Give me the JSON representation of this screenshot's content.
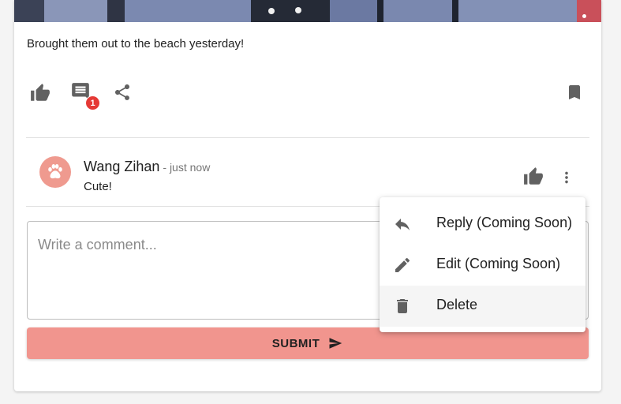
{
  "post": {
    "caption": "Brought them out to the beach yesterday!",
    "comment_count": "1",
    "actions": {
      "like_icon": "thumb-up-icon",
      "comment_icon": "comment-icon",
      "share_icon": "share-icon",
      "bookmark_icon": "bookmark-icon"
    }
  },
  "comment": {
    "author": "Wang Zihan",
    "timestamp": "- just now",
    "text": "Cute!",
    "avatar_icon": "paw-icon",
    "avatar_color": "#ef9a8f"
  },
  "comment_form": {
    "placeholder": "Write a comment...",
    "value": "",
    "submit_label": "SUBMIT",
    "submit_color": "#f1958e"
  },
  "context_menu": {
    "items": [
      {
        "label": "Reply (Coming Soon)",
        "icon": "reply-icon"
      },
      {
        "label": "Edit (Coming Soon)",
        "icon": "pencil-icon"
      },
      {
        "label": "Delete",
        "icon": "trash-icon"
      }
    ]
  }
}
